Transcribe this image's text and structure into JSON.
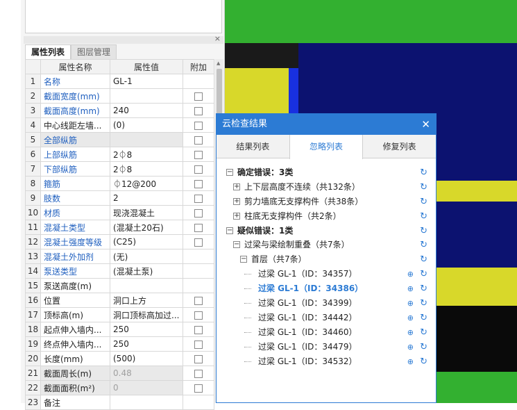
{
  "properties_panel": {
    "close_glyph": "×",
    "tabs": [
      "属性列表",
      "图层管理"
    ],
    "headers": [
      "属性名称",
      "属性值",
      "附加"
    ],
    "rows": [
      {
        "n": "1",
        "name": "名称",
        "value": "GL-1",
        "blue": true,
        "check": false,
        "shaded": false,
        "grey": false
      },
      {
        "n": "2",
        "name": "截面宽度(mm)",
        "value": "",
        "blue": true,
        "check": true,
        "shaded": false,
        "grey": false
      },
      {
        "n": "3",
        "name": "截面高度(mm)",
        "value": "240",
        "blue": true,
        "check": true,
        "shaded": false,
        "grey": false
      },
      {
        "n": "4",
        "name": "中心线距左墙...",
        "value": "(0)",
        "blue": false,
        "check": true,
        "shaded": false,
        "grey": false
      },
      {
        "n": "5",
        "name": "全部纵筋",
        "value": "",
        "blue": true,
        "check": true,
        "shaded": true,
        "grey": false
      },
      {
        "n": "6",
        "name": "上部纵筋",
        "value": "2⏀8",
        "blue": true,
        "check": true,
        "shaded": false,
        "grey": false
      },
      {
        "n": "7",
        "name": "下部纵筋",
        "value": "2⏀8",
        "blue": true,
        "check": true,
        "shaded": false,
        "grey": false
      },
      {
        "n": "8",
        "name": "箍筋",
        "value": "⏀12@200",
        "blue": true,
        "check": true,
        "shaded": false,
        "grey": false
      },
      {
        "n": "9",
        "name": "肢数",
        "value": "2",
        "blue": true,
        "check": true,
        "shaded": false,
        "grey": false
      },
      {
        "n": "10",
        "name": "材质",
        "value": "现浇混凝土",
        "blue": true,
        "check": true,
        "shaded": false,
        "grey": false
      },
      {
        "n": "11",
        "name": "混凝土类型",
        "value": "(混凝土20石)",
        "blue": true,
        "check": true,
        "shaded": false,
        "grey": false
      },
      {
        "n": "12",
        "name": "混凝土强度等级",
        "value": "(C25)",
        "blue": true,
        "check": true,
        "shaded": false,
        "grey": false
      },
      {
        "n": "13",
        "name": "混凝土外加剂",
        "value": "(无)",
        "blue": true,
        "check": false,
        "shaded": false,
        "grey": false
      },
      {
        "n": "14",
        "name": "泵送类型",
        "value": "(混凝土泵)",
        "blue": true,
        "check": false,
        "shaded": false,
        "grey": false
      },
      {
        "n": "15",
        "name": "泵送高度(m)",
        "value": "",
        "blue": false,
        "check": false,
        "shaded": false,
        "grey": false
      },
      {
        "n": "16",
        "name": "位置",
        "value": "洞口上方",
        "blue": false,
        "check": true,
        "shaded": false,
        "grey": false
      },
      {
        "n": "17",
        "name": "顶标高(m)",
        "value": "洞口顶标高加过...",
        "blue": false,
        "check": true,
        "shaded": false,
        "grey": false
      },
      {
        "n": "18",
        "name": "起点伸入墙内...",
        "value": "250",
        "blue": false,
        "check": true,
        "shaded": false,
        "grey": false
      },
      {
        "n": "19",
        "name": "终点伸入墙内...",
        "value": "250",
        "blue": false,
        "check": true,
        "shaded": false,
        "grey": false
      },
      {
        "n": "20",
        "name": "长度(mm)",
        "value": "(500)",
        "blue": false,
        "check": true,
        "shaded": false,
        "grey": false
      },
      {
        "n": "21",
        "name": "截面周长(m)",
        "value": "0.48",
        "blue": false,
        "check": true,
        "shaded": true,
        "grey": true
      },
      {
        "n": "22",
        "name": "截面面积(m²)",
        "value": "0",
        "blue": false,
        "check": true,
        "shaded": true,
        "grey": true
      },
      {
        "n": "23",
        "name": "备注",
        "value": "",
        "blue": false,
        "check": false,
        "shaded": false,
        "grey": false
      }
    ]
  },
  "dialog": {
    "title": "云检查结果",
    "close_glyph": "✕",
    "tabs": [
      "结果列表",
      "忽略列表",
      "修复列表"
    ],
    "active_tab": 1,
    "tree": [
      {
        "level": 0,
        "box": "−",
        "label": "确定错误：3类",
        "bold": true,
        "sel": false,
        "loc": false
      },
      {
        "level": 1,
        "box": "+",
        "label": "上下层高度不连续（共132条）",
        "bold": false,
        "sel": false,
        "loc": false
      },
      {
        "level": 1,
        "box": "+",
        "label": "剪力墙底无支撑构件（共38条）",
        "bold": false,
        "sel": false,
        "loc": false
      },
      {
        "level": 1,
        "box": "+",
        "label": "柱底无支撑构件（共2条）",
        "bold": false,
        "sel": false,
        "loc": false
      },
      {
        "level": 0,
        "box": "−",
        "label": "疑似错误：1类",
        "bold": true,
        "sel": false,
        "loc": false
      },
      {
        "level": 1,
        "box": "−",
        "label": "过梁与梁绘制重叠（共7条）",
        "bold": false,
        "sel": false,
        "loc": false
      },
      {
        "level": 2,
        "box": "−",
        "label": "首层（共7条）",
        "bold": false,
        "sel": false,
        "loc": false
      },
      {
        "level": 3,
        "box": "",
        "label": "过梁 GL-1（ID：34357）",
        "bold": false,
        "sel": false,
        "loc": true
      },
      {
        "level": 3,
        "box": "",
        "label": "过梁 GL-1（ID：34386）",
        "bold": false,
        "sel": true,
        "loc": true
      },
      {
        "level": 3,
        "box": "",
        "label": "过梁 GL-1（ID：34399）",
        "bold": false,
        "sel": false,
        "loc": true
      },
      {
        "level": 3,
        "box": "",
        "label": "过梁 GL-1（ID：34442）",
        "bold": false,
        "sel": false,
        "loc": true
      },
      {
        "level": 3,
        "box": "",
        "label": "过梁 GL-1（ID：34460）",
        "bold": false,
        "sel": false,
        "loc": true
      },
      {
        "level": 3,
        "box": "",
        "label": "过梁 GL-1（ID：34479）",
        "bold": false,
        "sel": false,
        "loc": true
      },
      {
        "level": 3,
        "box": "",
        "label": "过梁 GL-1（ID：34532）",
        "bold": false,
        "sel": false,
        "loc": true
      }
    ],
    "refresh_glyph": "↻",
    "locate_glyph": "⊕"
  },
  "colors": {
    "dialog_accent": "#2c7bd4",
    "viewport_green": "#33b030",
    "viewport_navy": "#0c1270",
    "viewport_yellow": "#d8d82a",
    "viewport_blue": "#1830e0"
  }
}
